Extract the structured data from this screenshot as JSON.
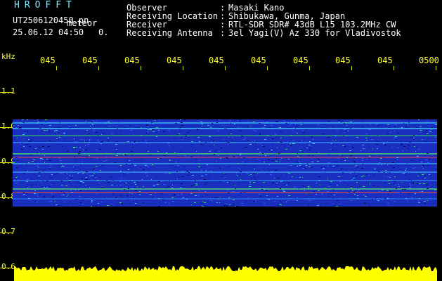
{
  "header": {
    "app_title": "HROFFT",
    "file_name": "UT2506120450.pn",
    "meteor_label": "meteor",
    "datetime": "25.06.12 04:50",
    "count": "0.",
    "info": [
      {
        "label": "Observer",
        "value": "Masaki Kano"
      },
      {
        "label": "Receiving Location",
        "value": "Shibukawa, Gunma, Japan"
      },
      {
        "label": "Receiver",
        "value": "RTL-SDR SDR# 43dB L15 103.2MHz CW"
      },
      {
        "label": "Receiving Antenna",
        "value": "3el Yagi(V) Az 330 for Vladivostok"
      }
    ]
  },
  "axis": {
    "unit": "kHz",
    "time_labels": [
      "045",
      "045",
      "045",
      "045",
      "045",
      "045",
      "045",
      "045",
      "045",
      "0500"
    ],
    "freq_labels": [
      "1.1",
      "1.0",
      "0.9",
      "0.8",
      "0.7",
      "0.6"
    ]
  },
  "colors": {
    "header_cyan": "#7fe8ff",
    "axis_yellow": "#ffff33",
    "meter_yellow": "#ffff00",
    "background": "#000000",
    "spectrum_blue": "#1a2fbf"
  }
}
